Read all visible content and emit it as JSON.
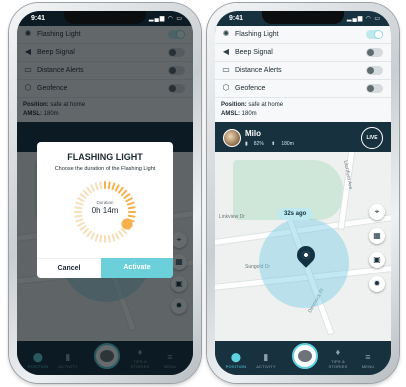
{
  "status": {
    "time": "9:41",
    "icons": "signal-wifi-battery"
  },
  "settings": {
    "items": [
      {
        "label": "Flashing Light",
        "icon": "flashlight-icon"
      },
      {
        "label": "Beep Signal",
        "icon": "speaker-icon"
      },
      {
        "label": "Distance Alerts",
        "icon": "distance-icon"
      },
      {
        "label": "Geofence",
        "icon": "geofence-icon"
      }
    ],
    "toggles_left": [
      true,
      false,
      false,
      false
    ],
    "toggles_right": [
      true,
      false,
      false,
      false
    ]
  },
  "position": {
    "label": "Position:",
    "value": "safe at home"
  },
  "amsl": {
    "label": "AMSL:",
    "value": "180m"
  },
  "pet": {
    "name": "Milo",
    "battery": "82%",
    "distance": "180m",
    "live": "LIVE"
  },
  "map": {
    "last_seen": "32s ago",
    "streets": [
      "Linkview Dr",
      "Sungold Dr",
      "Dimmock Pl",
      "Litchfield Ave"
    ]
  },
  "nav": {
    "position": "POSITION",
    "activity": "ACTIVITY",
    "tips": "TIPS & STORIES",
    "menu": "MENU"
  },
  "dialog": {
    "title": "FLASHING LIGHT",
    "subtitle": "Choose the duration of the Flashing Light",
    "duration_label": "Duration",
    "duration_value": "0h 14m",
    "cancel": "Cancel",
    "activate": "Activate"
  },
  "colors": {
    "accent": "#6cd0da",
    "navy": "#17313f",
    "dial": "#f5b14c"
  }
}
